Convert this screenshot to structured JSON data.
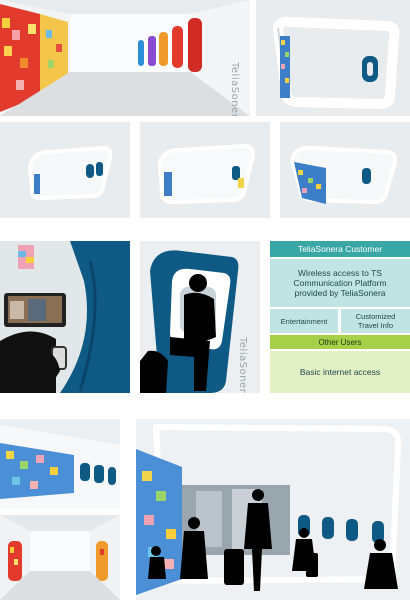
{
  "brand": {
    "logo_text": "TeliaSonera"
  },
  "table": {
    "header": "TeliaSonera Customer",
    "wireless_text": "Wireless access to TS Communication Platform provided by TeliaSonera",
    "entertainment": "Entertainment",
    "customized": "Customized Travel Info",
    "other_header": "Other Users",
    "basic": "Basic internet access"
  },
  "colors": {
    "teal_header": "#3aa7a7",
    "teal_light": "#bfe4e2",
    "green_header": "#a7cf47",
    "green_light": "#e2f0c4",
    "seat_blue": "#0e5a84",
    "wall": "#e9eced"
  }
}
